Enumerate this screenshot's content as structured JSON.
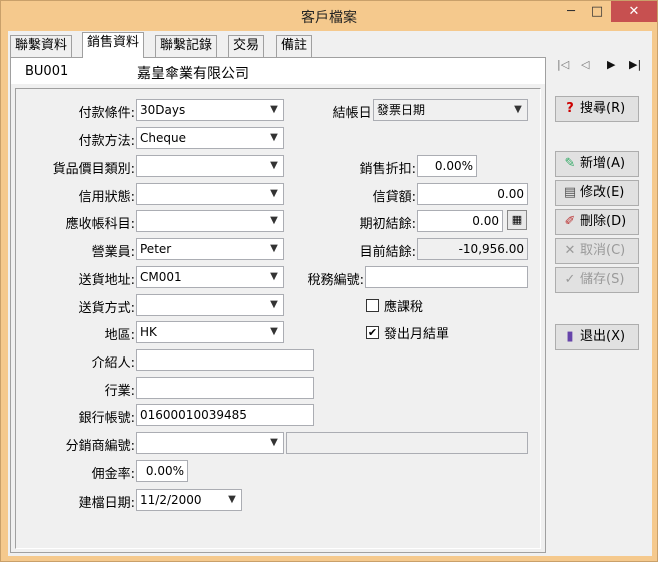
{
  "window": {
    "title": "客戶檔案",
    "min": "─",
    "max": "□",
    "close": "✕"
  },
  "tabs": [
    "聯繫資料",
    "銷售資料",
    "聯繫記錄",
    "交易",
    "備註"
  ],
  "header": {
    "code": "BU001",
    "name": "嘉皇傘業有限公司"
  },
  "form": {
    "payment_terms": {
      "label": "付款條件:",
      "value": "30Days"
    },
    "payment_method": {
      "label": "付款方法:",
      "value": "Cheque"
    },
    "price_category": {
      "label": "貨品價目類別:",
      "value": ""
    },
    "credit_status": {
      "label": "信用狀態:",
      "value": ""
    },
    "ar_account": {
      "label": "應收帳科目:",
      "value": ""
    },
    "salesperson": {
      "label": "營業員:",
      "value": "Peter"
    },
    "delivery_address": {
      "label": "送貨地址:",
      "value": "CM001"
    },
    "delivery_method": {
      "label": "送貨方式:",
      "value": ""
    },
    "region": {
      "label": "地區:",
      "value": "HK"
    },
    "referrer": {
      "label": "介紹人:",
      "value": ""
    },
    "industry": {
      "label": "行業:",
      "value": ""
    },
    "bank_account": {
      "label": "銀行帳號:",
      "value": "01600010039485"
    },
    "distributor_no": {
      "label": "分銷商編號:",
      "value": "",
      "extra": ""
    },
    "commission_rate": {
      "label": "佣金率:",
      "value": "0.00%"
    },
    "created_date": {
      "label": "建檔日期:",
      "value": "11/2/2000"
    },
    "closing_date": {
      "label": "結帳日:",
      "value": "發票日期"
    },
    "sales_discount": {
      "label": "銷售折扣:",
      "value": "0.00%"
    },
    "credit_limit": {
      "label": "信貸額:",
      "value": "0.00"
    },
    "opening_balance": {
      "label": "期初結餘:",
      "value": "0.00"
    },
    "current_balance": {
      "label": "目前結餘:",
      "value": "-10,956.00"
    },
    "tax_no": {
      "label": "稅務編號:",
      "value": ""
    },
    "taxable": {
      "label": "應課稅",
      "checked": false
    },
    "monthly_statement": {
      "label": "發出月結單",
      "checked": true
    }
  },
  "nav": {
    "first": "|◁",
    "prev": "◁",
    "next": "▶",
    "last": "▶|"
  },
  "buttons": {
    "search": {
      "icon": "?",
      "label": "搜尋(R)"
    },
    "add": {
      "icon": "✎",
      "label": "新增(A)"
    },
    "edit": {
      "icon": "▤",
      "label": "修改(E)"
    },
    "delete": {
      "icon": "✐",
      "label": "刪除(D)"
    },
    "cancel": {
      "icon": "✕",
      "label": "取消(C)"
    },
    "save": {
      "icon": "✓",
      "label": "儲存(S)"
    },
    "exit": {
      "icon": "▮",
      "label": "退出(X)"
    }
  },
  "caret": "▼",
  "check_mark": "✔"
}
